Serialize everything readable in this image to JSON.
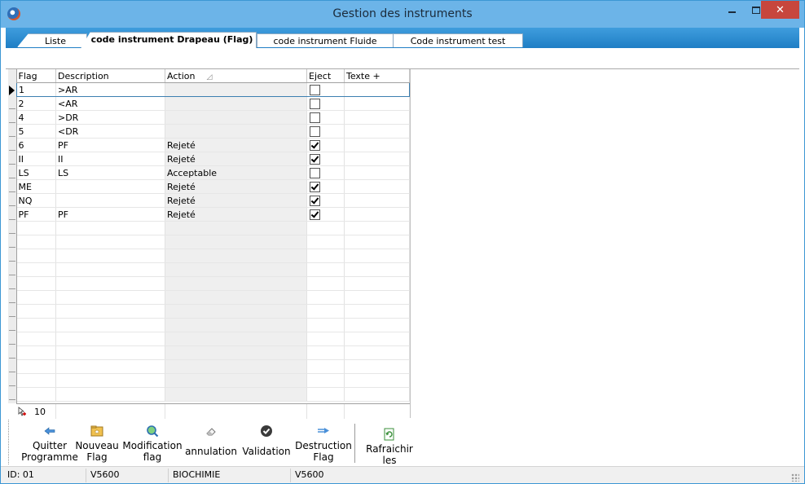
{
  "window": {
    "title": "Gestion des instruments"
  },
  "tabs": [
    {
      "label": "Liste"
    },
    {
      "label": "code instrument Drapeau (Flag)"
    },
    {
      "label": "code instrument Fluide"
    },
    {
      "label": "Code instrument test"
    }
  ],
  "active_tab": 1,
  "grid": {
    "columns": [
      "Flag",
      "Description",
      "Action",
      "Eject",
      "Texte",
      "+"
    ],
    "sorted_column": "Action",
    "rows": [
      {
        "flag": "1",
        "description": ">AR",
        "action": "",
        "eject": false
      },
      {
        "flag": "2",
        "description": "<AR",
        "action": "",
        "eject": false
      },
      {
        "flag": "4",
        "description": ">DR",
        "action": "",
        "eject": false
      },
      {
        "flag": "5",
        "description": "<DR",
        "action": "",
        "eject": false
      },
      {
        "flag": "6",
        "description": "PF",
        "action": "Rejeté",
        "eject": true
      },
      {
        "flag": "II",
        "description": "II",
        "action": "Rejeté",
        "eject": true
      },
      {
        "flag": "LS",
        "description": "LS",
        "action": "Acceptable",
        "eject": false
      },
      {
        "flag": "ME",
        "description": "",
        "action": "Rejeté",
        "eject": true
      },
      {
        "flag": "NQ",
        "description": "",
        "action": "Rejeté",
        "eject": true
      },
      {
        "flag": "PF",
        "description": "PF",
        "action": "Rejeté",
        "eject": true
      }
    ],
    "record_count": "10"
  },
  "toolbar": {
    "quit_line1": "Quitter",
    "quit_line2": "Programme",
    "new_line1": "Nouveau",
    "new_line2": "Flag",
    "modify_line1": "Modification",
    "modify_line2": "flag",
    "cancel": "annulation",
    "validate": "Validation",
    "delete_line1": "Destruction",
    "delete_line2": "Flag",
    "refresh": "Rafraichir les"
  },
  "status": {
    "id": "ID: 01",
    "instrument": "V5600",
    "department": "BIOCHIMIE",
    "instrument2": "V5600"
  },
  "colors": {
    "titlebar": "#6cb4e8",
    "tabbar": "#2c8bd0",
    "close_button": "#c7463d",
    "action_column": "#efefef"
  }
}
